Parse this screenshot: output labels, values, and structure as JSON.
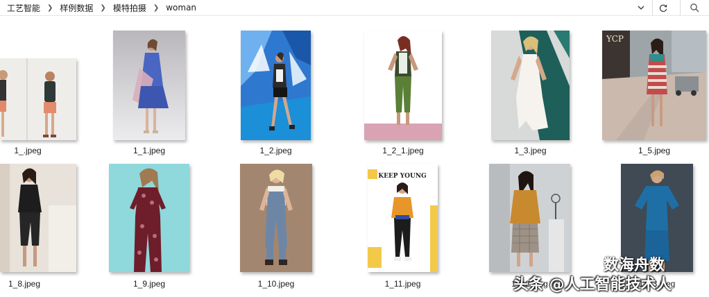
{
  "breadcrumb": [
    "工艺智能",
    "样例数据",
    "模特拍摄",
    "woman"
  ],
  "files": [
    {
      "name": "1_.jpeg"
    },
    {
      "name": "1_1.jpeg"
    },
    {
      "name": "1_2.jpeg"
    },
    {
      "name": "1_2_1.jpeg"
    },
    {
      "name": "1_3.jpeg"
    },
    {
      "name": "1_5.jpeg"
    },
    {
      "name": "1_8.jpeg"
    },
    {
      "name": "1_9.jpeg"
    },
    {
      "name": "1_10.jpeg"
    },
    {
      "name": "1_11.jpeg"
    },
    {
      "name": "1_12.jpeg"
    },
    {
      "name": "1_13.jpeg"
    }
  ],
  "thumb_text": {
    "poster_heading": "KEEP YOUNG",
    "sign": "YCP"
  },
  "watermark": {
    "line": "头条 @人工智能技术人",
    "account": "数海舟数"
  },
  "icons": {
    "dropdown": "chevron-down-icon",
    "refresh": "refresh-icon",
    "search": "search-icon",
    "wm": "wechat-icon"
  }
}
